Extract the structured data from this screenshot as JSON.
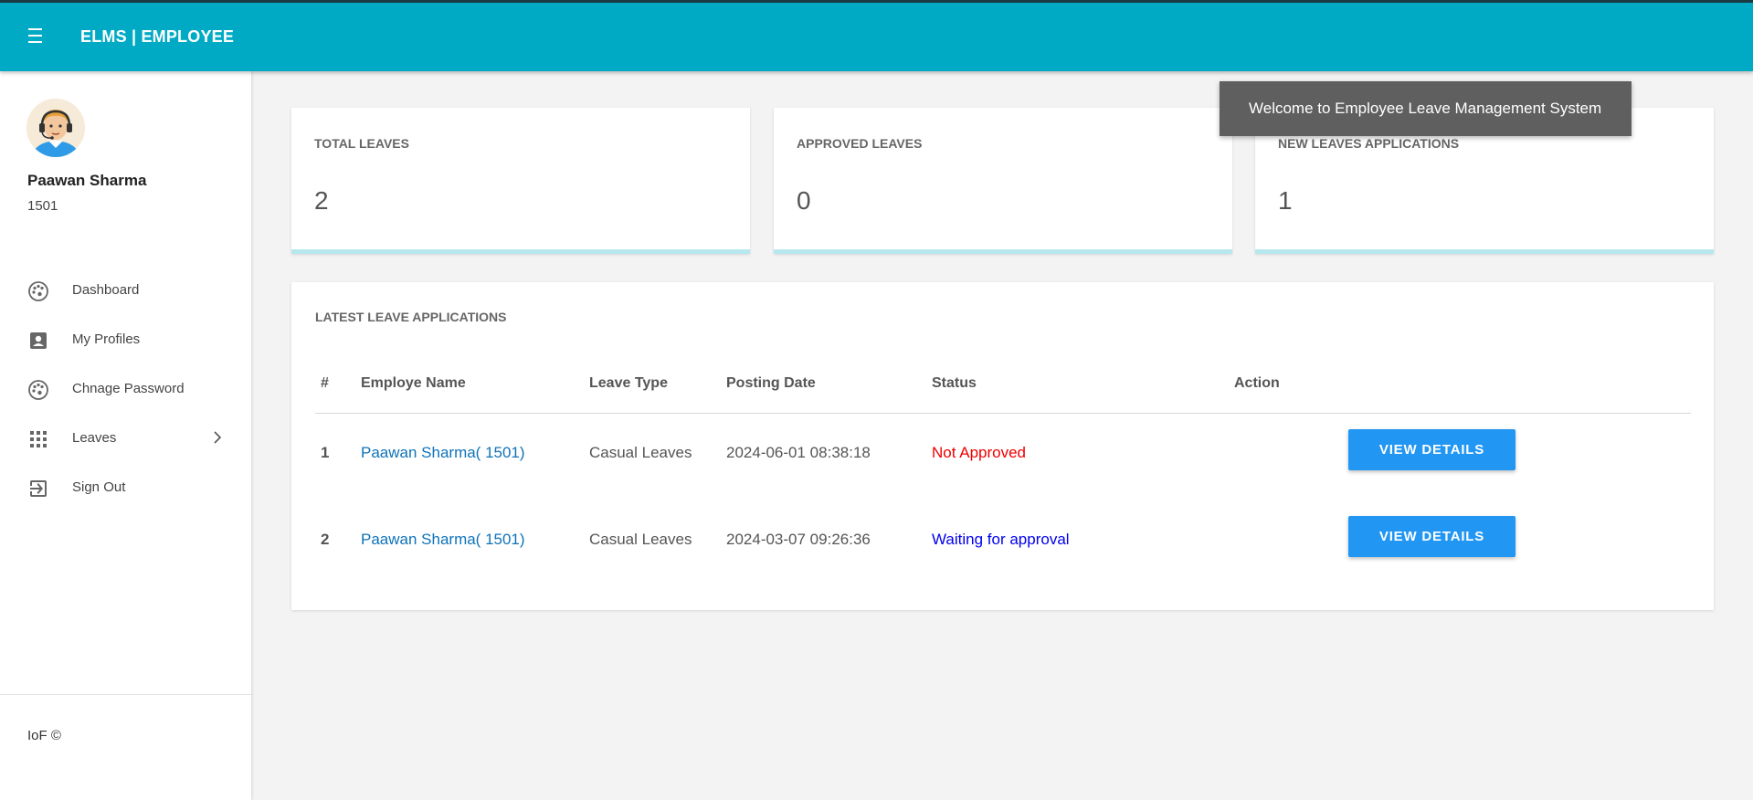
{
  "app": {
    "brand": "ELMS | EMPLOYEE"
  },
  "user": {
    "name": "Paawan Sharma",
    "id": "1501"
  },
  "sidebar": {
    "items": [
      {
        "label": "Dashboard",
        "icon": "dashboard-icon"
      },
      {
        "label": "My Profiles",
        "icon": "profile-icon"
      },
      {
        "label": "Chnage Password",
        "icon": "password-icon"
      },
      {
        "label": "Leaves",
        "icon": "apps-grid-icon",
        "has_submenu": true
      },
      {
        "label": "Sign Out",
        "icon": "sign-out-icon"
      }
    ],
    "footer": "IoF ©"
  },
  "stats": [
    {
      "title": "TOTAL LEAVES",
      "value": "2"
    },
    {
      "title": "APPROVED LEAVES",
      "value": "0"
    },
    {
      "title": "NEW LEAVES APPLICATIONS",
      "value": "1"
    }
  ],
  "latest": {
    "title": "LATEST LEAVE APPLICATIONS",
    "columns": [
      "#",
      "Employe Name",
      "Leave Type",
      "Posting Date",
      "Status",
      "Action"
    ],
    "rows": [
      {
        "num": "1",
        "name": "Paawan Sharma( 1501)",
        "type": "Casual Leaves",
        "date": "2024-06-01 08:38:18",
        "status": "Not Approved",
        "action": "VIEW DETAILS"
      },
      {
        "num": "2",
        "name": "Paawan Sharma( 1501)",
        "type": "Casual Leaves",
        "date": "2024-03-07 09:26:36",
        "status": "Waiting for approval",
        "action": "VIEW DETAILS"
      }
    ]
  },
  "toast": {
    "message": "Welcome to Employee Leave Management System"
  },
  "colors": {
    "navbar": "#00aac4",
    "button": "#2196f3",
    "status_not_approved": "#ee0000",
    "status_waiting": "#0000ee",
    "link": "#0f73b8",
    "card_accent": "#b7e8ee"
  }
}
